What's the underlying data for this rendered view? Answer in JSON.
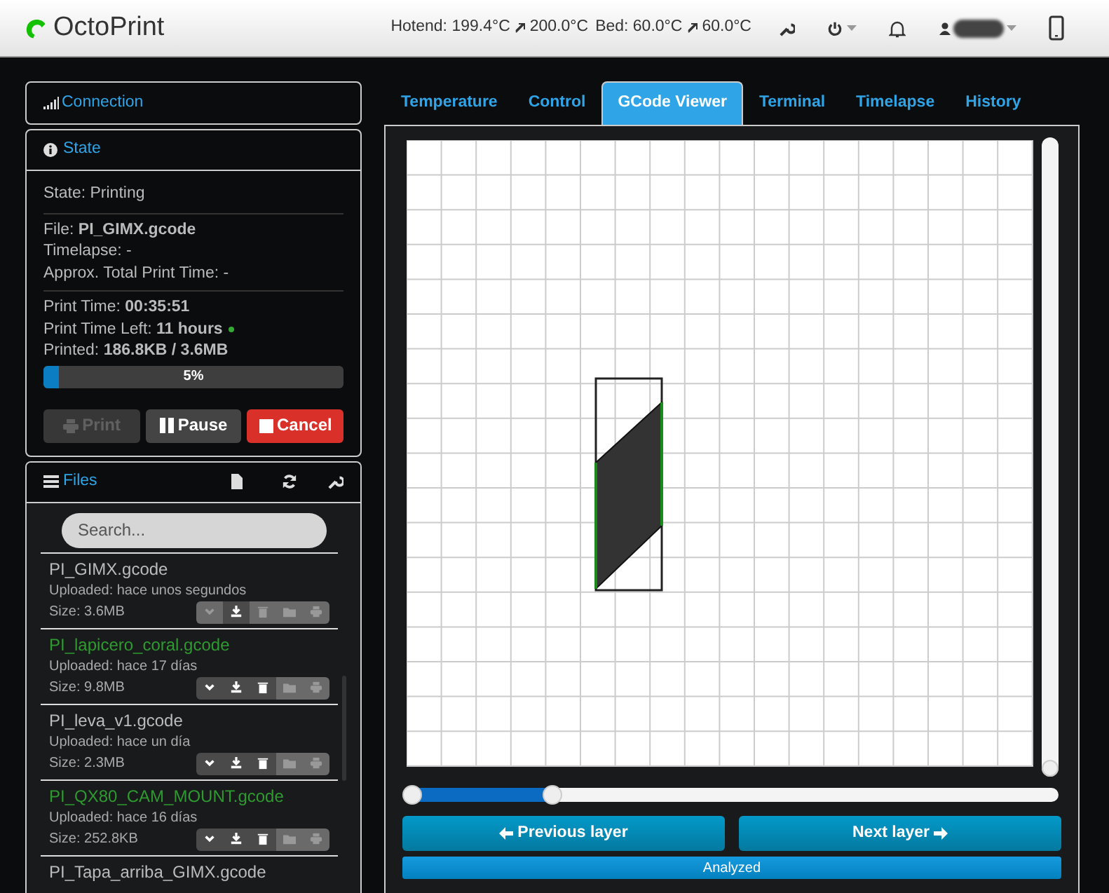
{
  "navbar": {
    "brand": "OctoPrint",
    "temps": [
      {
        "label": "Hotend: 199.4°C",
        "target": "200.0°C"
      },
      {
        "label": "Bed: 60.0°C",
        "target": "60.0°C"
      }
    ]
  },
  "sidebar": {
    "connection": {
      "title": "Connection"
    },
    "state": {
      "title": "State",
      "status": "State: Printing",
      "info": [
        {
          "label": "File: ",
          "value": "PI_GIMX.gcode"
        },
        {
          "label": "Timelapse: -"
        },
        {
          "label": "Approx. Total Print Time: -"
        }
      ],
      "times": [
        {
          "label": "Print Time: ",
          "value": "00:35:51",
          "dot": false
        },
        {
          "label": "Print Time Left: ",
          "value": "11 hours",
          "dot": true
        },
        {
          "label": "Printed: ",
          "value": "186.8KB / 3.6MB",
          "dot": false
        }
      ],
      "progress": {
        "level": 0.05,
        "reading": "5%"
      },
      "buttons": [
        {
          "kind": "print",
          "label": "Print",
          "disabled": true
        },
        {
          "kind": "pause",
          "label": "Pause",
          "disabled": false
        },
        {
          "kind": "cancel",
          "label": "Cancel",
          "disabled": false
        }
      ]
    },
    "files": {
      "title": "Files",
      "search": {
        "placeholder": "Search..."
      },
      "items": [
        {
          "name": "PI_GIMX.gcode",
          "uploaded": "Uploaded: hace unos segundos",
          "size": "Size: 3.6MB",
          "printed": false,
          "in_use": true
        },
        {
          "name": "PI_lapicero_coral.gcode",
          "uploaded": "Uploaded: hace 17 días",
          "size": "Size: 9.8MB",
          "printed": true,
          "in_use": false
        },
        {
          "name": "PI_leva_v1.gcode",
          "uploaded": "Uploaded: hace un día",
          "size": "Size: 2.3MB",
          "printed": false,
          "in_use": false
        },
        {
          "name": "PI_QX80_CAM_MOUNT.gcode",
          "uploaded": "Uploaded: hace 16 días",
          "size": "Size: 252.8KB",
          "printed": true,
          "in_use": false
        },
        {
          "name": "PI_Tapa_arriba_GIMX.gcode",
          "printed": false
        }
      ]
    }
  },
  "tabs": [
    {
      "label": "Temperature",
      "selected": false
    },
    {
      "label": "Control",
      "selected": false
    },
    {
      "label": "GCode Viewer",
      "selected": true
    },
    {
      "label": "Terminal",
      "selected": false
    },
    {
      "label": "Timelapse",
      "selected": false
    },
    {
      "label": "History",
      "selected": false
    }
  ],
  "viewer": {
    "zoom_slider": {
      "level": 0
    },
    "layer_slider": {
      "level": 0.22
    },
    "previous": "Previous layer",
    "next": "Next layer",
    "status": "Analyzed"
  }
}
